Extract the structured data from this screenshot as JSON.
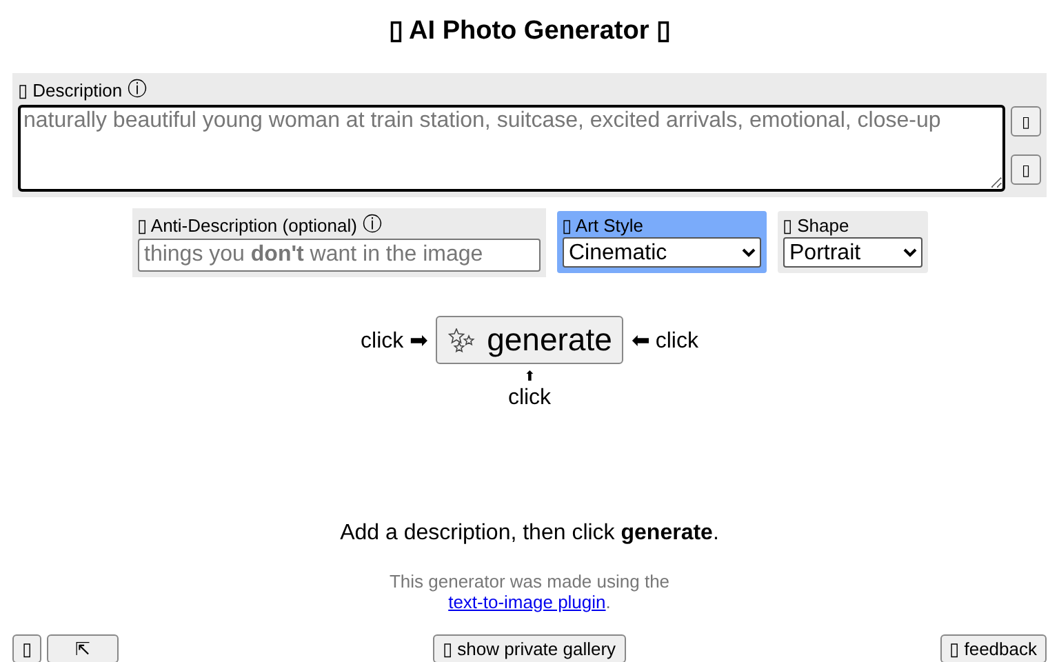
{
  "title": "▯ AI Photo Generator ▯",
  "description": {
    "label": "▯ Description",
    "info": "ⓘ",
    "placeholder": "naturally beautiful young woman at train station, suitcase, excited arrivals, emotional, close-up",
    "side_buttons": [
      "▯",
      "▯"
    ]
  },
  "anti_description": {
    "label": "▯ Anti-Description (optional)",
    "info": "ⓘ",
    "placeholder": "things you **don't** want in the image"
  },
  "art_style": {
    "label": "▯ Art Style",
    "value": "Cinematic",
    "highlighted": true
  },
  "shape": {
    "label": "▯ Shape",
    "value": "Portrait",
    "highlighted": false
  },
  "generate": {
    "label": "generate",
    "left_hint": "click ➡",
    "right_hint": "⬅ click",
    "below_arrow": "⬆",
    "below_hint": "click"
  },
  "message": "Add a description, then click **generate**.",
  "credit": {
    "text": "This generator was made using the",
    "link": "text-to-image plugin",
    "after": "."
  },
  "footer": {
    "left_buttons": [
      "▯",
      "⇱"
    ],
    "center_button": "▯ show private gallery",
    "right_button": "▯ feedback"
  }
}
